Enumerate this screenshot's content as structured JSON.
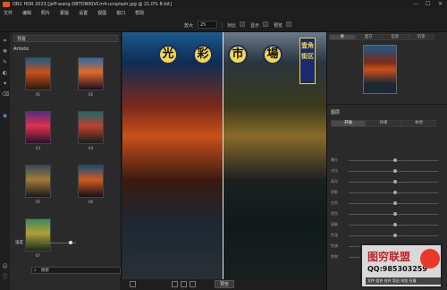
{
  "window": {
    "title": "ON1 HDR 2023 [jeff-wang-DBTOWKIVCm4-unsplash.jpg @ 21.0% 8-bit]",
    "minimize": "—",
    "maximize": "☐",
    "close": "✕"
  },
  "menu": [
    "文件",
    "编辑",
    "照片",
    "蒙版",
    "设置",
    "视图",
    "窗口",
    "帮助"
  ],
  "toolbar": {
    "zoom_label": "放大",
    "zoom_value": "25",
    "compare_label": "对比",
    "grid_label": "显示",
    "overlay_label": "预览"
  },
  "left_panel": {
    "top_dropdown": "预置",
    "section_title": "Artistic",
    "presets": [
      {
        "label": "01"
      },
      {
        "label": "02"
      },
      {
        "label": "03"
      },
      {
        "label": "04"
      },
      {
        "label": "05"
      },
      {
        "label": "06"
      },
      {
        "label": "07"
      }
    ],
    "slider_label": "强度",
    "search_placeholder": "搜索"
  },
  "canvas": {
    "sign_chars": [
      "光",
      "彩",
      "市",
      "場"
    ],
    "vertical_sign": "壹角街区"
  },
  "bottom_bar": {
    "preview_button": "预览"
  },
  "right_panel": {
    "tabs": [
      "导",
      "直方",
      "信息",
      "历史"
    ],
    "section_label": "图层",
    "tabs2": [
      "开发",
      "效果",
      "本地"
    ],
    "slider_rows": [
      "曝光",
      "对比",
      "高光",
      "阴影",
      "白色",
      "黑色",
      "清晰",
      "色温",
      "色调",
      "饱和"
    ]
  },
  "watermark": {
    "title": "图穷联盟",
    "qq": "QQ:985303259",
    "bottom": "文件 组合 合并 导出 浏览 扫描"
  }
}
